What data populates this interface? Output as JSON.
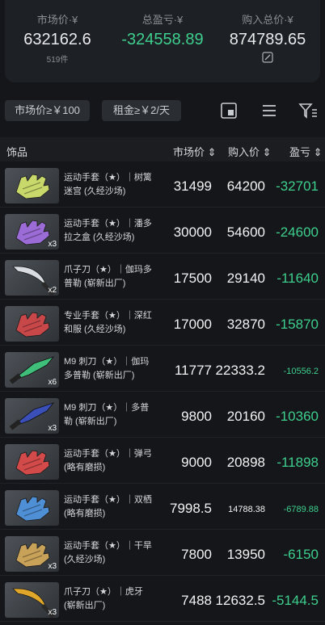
{
  "summary": {
    "market_label": "市场价·¥",
    "market_value": "632162.6",
    "market_count": "519件",
    "pnl_label": "总盈亏·¥",
    "pnl_value": "-324558.89",
    "cost_label": "购入总价·¥",
    "cost_value": "874789.65"
  },
  "filters": {
    "market_filter": "市场价≥￥100",
    "rent_filter": "租金≥￥2/天"
  },
  "table": {
    "col_item": "饰品",
    "col_market": "市场价 ⇕",
    "col_buy": "购入价 ⇕",
    "col_pnl": "盈亏 ⇕",
    "rows": [
      {
        "line1": "运动手套（★）｜树篱",
        "line2": "迷宫 (久经沙场)",
        "qty": "",
        "market": "31499",
        "buy": "64200",
        "pnl": "-32701",
        "color": "#c9d86a",
        "kind": "glove"
      },
      {
        "line1": "运动手套（★）｜潘多",
        "line2": "拉之盒 (久经沙场)",
        "qty": "x3",
        "market": "30000",
        "buy": "54600",
        "pnl": "-24600",
        "color": "#9b6bd6",
        "kind": "glove"
      },
      {
        "line1": "爪子刀（★）｜伽玛多",
        "line2": "普勒 (崭新出厂)",
        "qty": "x2",
        "market": "17500",
        "buy": "29140",
        "pnl": "-11640",
        "color": "#d9dde2",
        "kind": "karambit"
      },
      {
        "line1": "专业手套（★）｜深红",
        "line2": "和服 (久经沙场)",
        "qty": "",
        "market": "17000",
        "buy": "32870",
        "pnl": "-15870",
        "color": "#c8484a",
        "kind": "glove"
      },
      {
        "line1": "M9 刺刀（★）｜伽玛",
        "line2": "多普勒 (崭新出厂)",
        "qty": "x6",
        "market": "11777",
        "buy": "22333.2",
        "pnl": "-10556.2",
        "color": "#3fbf7a",
        "kind": "knife"
      },
      {
        "line1": "M9 刺刀（★）｜多普",
        "line2": "勒 (崭新出厂)",
        "qty": "x3",
        "market": "9800",
        "buy": "20160",
        "pnl": "-10360",
        "color": "#3a4fb8",
        "kind": "knife"
      },
      {
        "line1": "运动手套（★）｜弹弓",
        "line2": "(略有磨损)",
        "qty": "",
        "market": "9000",
        "buy": "20898",
        "pnl": "-11898",
        "color": "#d24a4a",
        "kind": "glove"
      },
      {
        "line1": "运动手套（★）｜双栖",
        "line2": "(略有磨损)",
        "qty": "",
        "market": "7998.5",
        "buy": "14788.38",
        "pnl": "-6789.88",
        "color": "#4f8fd6",
        "kind": "glove"
      },
      {
        "line1": "运动手套（★）｜干旱",
        "line2": "(久经沙场)",
        "qty": "x3",
        "market": "7800",
        "buy": "13950",
        "pnl": "-6150",
        "color": "#c9a25a",
        "kind": "glove"
      },
      {
        "line1": "爪子刀（★）｜虎牙",
        "line2": "(崭新出厂)",
        "qty": "x3",
        "market": "7488",
        "buy": "12632.5",
        "pnl": "-5144.5",
        "color": "#e0a72a",
        "kind": "karambit"
      }
    ]
  }
}
